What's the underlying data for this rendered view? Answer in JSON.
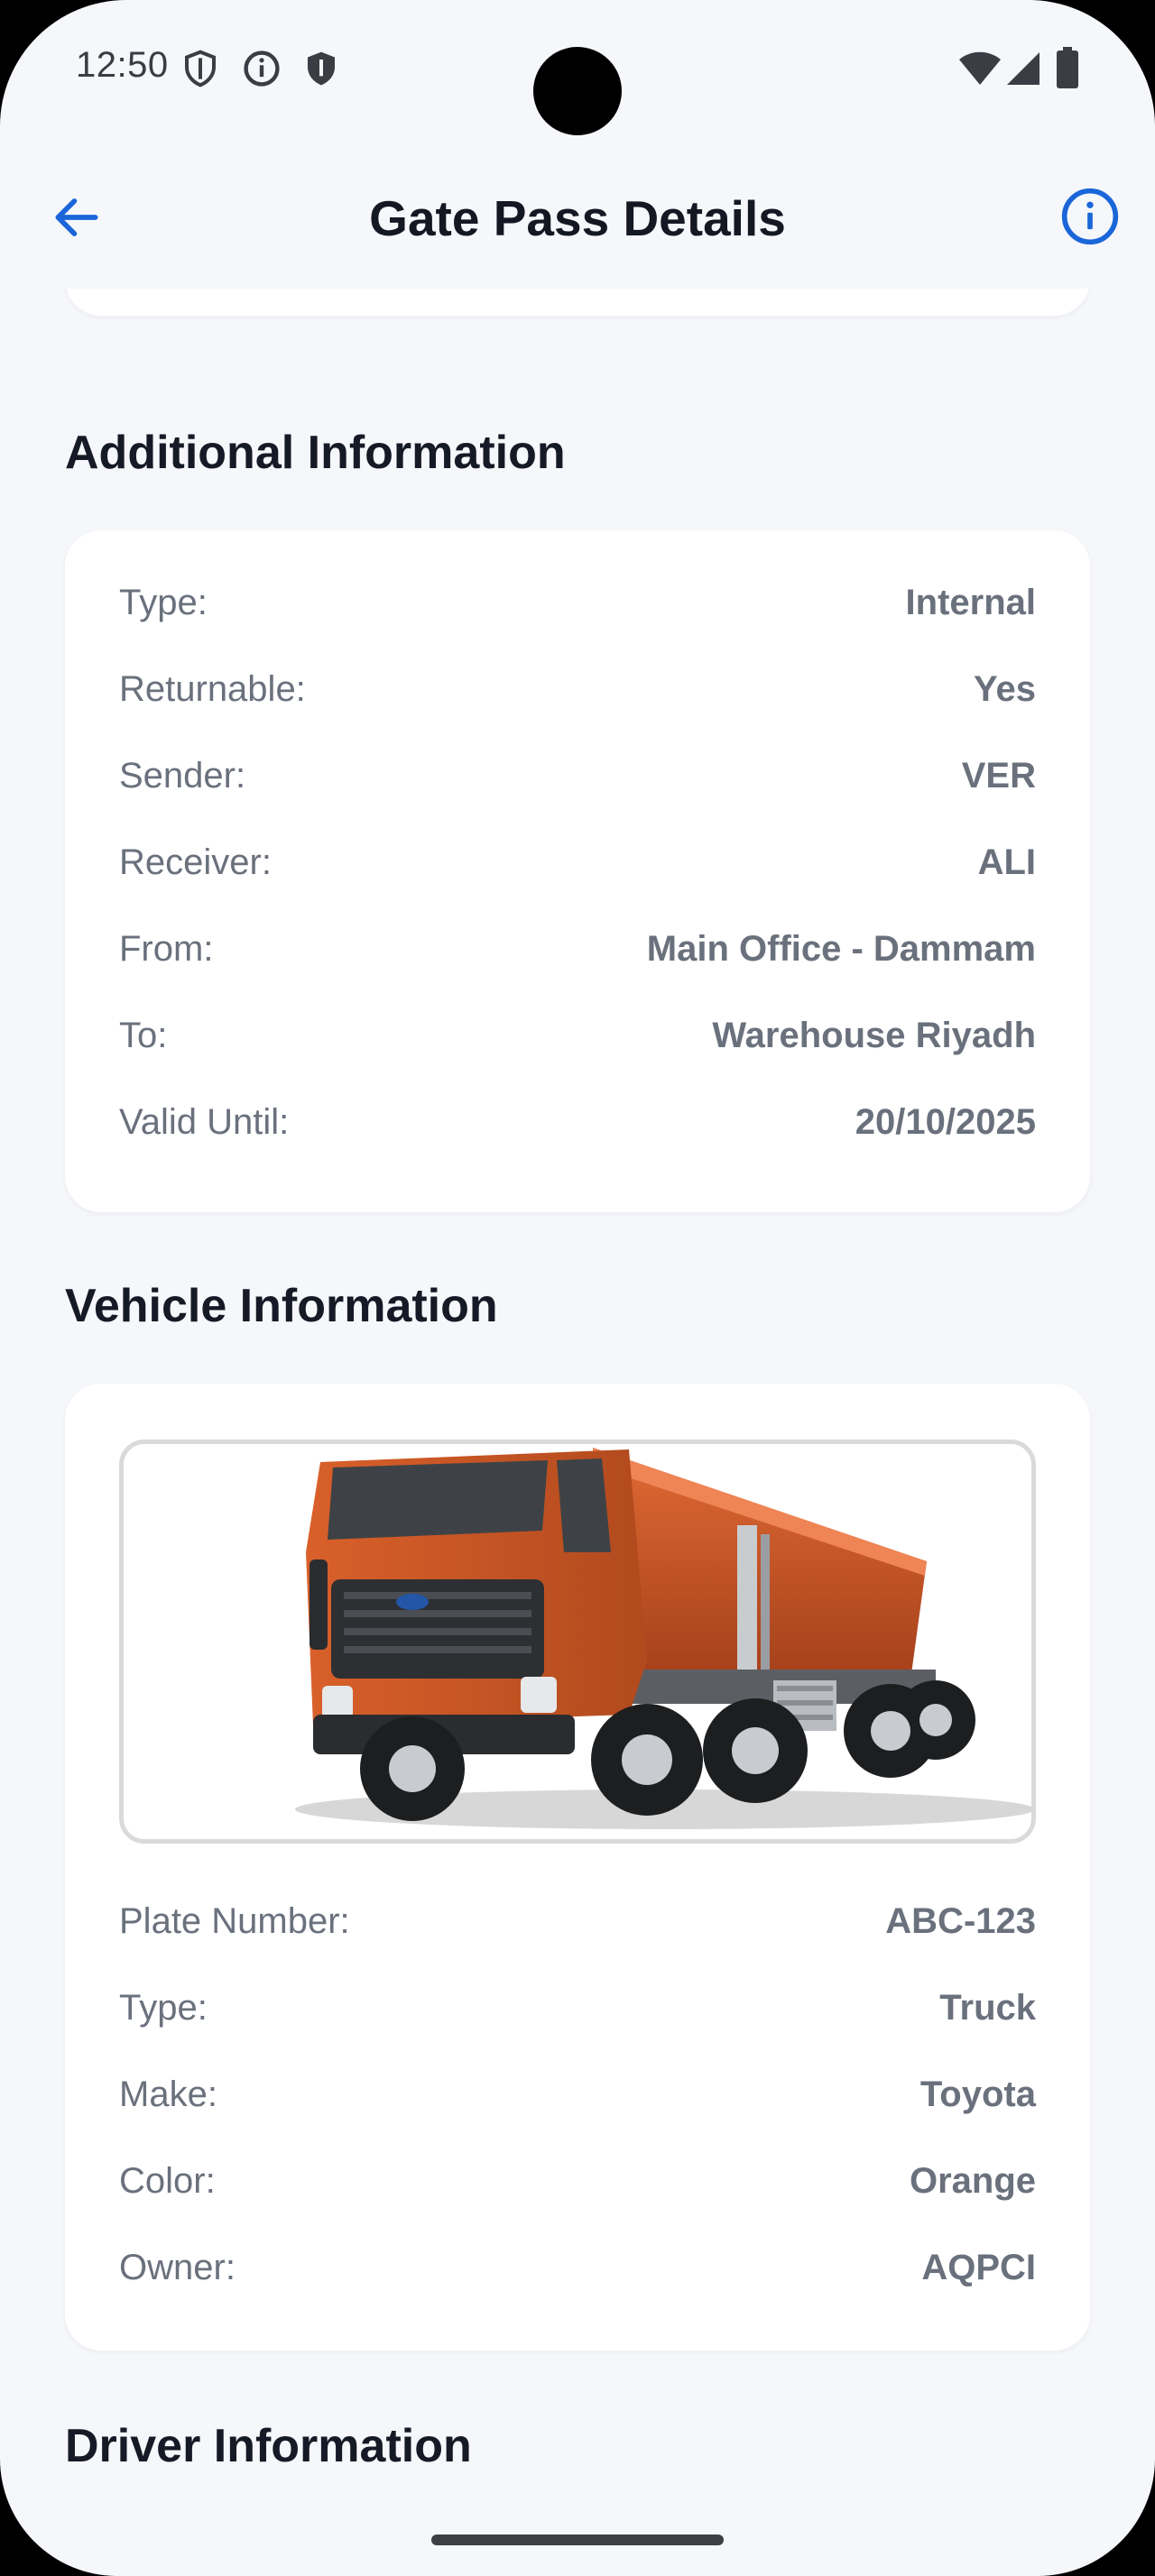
{
  "status_bar": {
    "time": "12:50",
    "icons": [
      "shield-outline-icon",
      "info-circle-icon",
      "shield-filled-icon",
      "wifi-icon",
      "signal-icon",
      "battery-icon"
    ]
  },
  "app_bar": {
    "title": "Gate Pass Details",
    "back_icon": "arrow-back-icon",
    "info_icon": "info-outline-icon",
    "accent_color": "#1a66d9"
  },
  "additional_information": {
    "title": "Additional Information",
    "rows": [
      {
        "label": "Type:",
        "value": "Internal"
      },
      {
        "label": "Returnable:",
        "value": "Yes"
      },
      {
        "label": "Sender:",
        "value": "VER"
      },
      {
        "label": "Receiver:",
        "value": "ALI"
      },
      {
        "label": "From:",
        "value": "Main Office - Dammam"
      },
      {
        "label": "To:",
        "value": "Warehouse Riyadh"
      },
      {
        "label": "Valid Until:",
        "value": "20/10/2025"
      }
    ]
  },
  "vehicle_information": {
    "title": "Vehicle Information",
    "image": "orange-dump-truck-image",
    "rows": [
      {
        "label": "Plate Number:",
        "value": "ABC-123"
      },
      {
        "label": "Type:",
        "value": "Truck"
      },
      {
        "label": "Make:",
        "value": "Toyota"
      },
      {
        "label": "Color:",
        "value": "Orange"
      },
      {
        "label": "Owner:",
        "value": "AQPCI"
      }
    ]
  },
  "driver_information": {
    "title": "Driver Information"
  }
}
